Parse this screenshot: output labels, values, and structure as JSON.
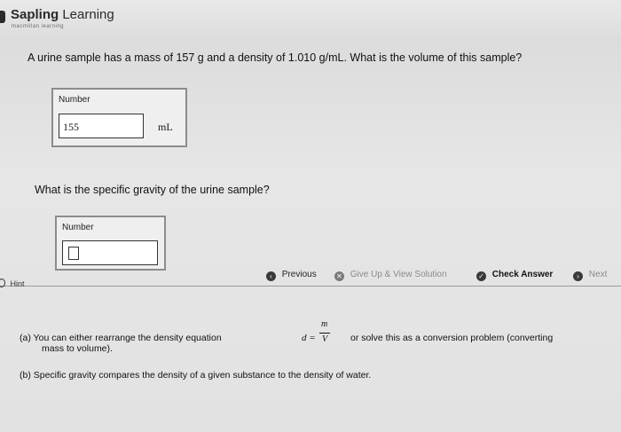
{
  "header": {
    "brand": "Sapling",
    "brand_suffix": "Learning",
    "sub": "macmillan learning"
  },
  "question1": {
    "text": "A urine sample has a mass of 157 g and a density of 1.010 g/mL. What is the volume of this sample?",
    "box_label": "Number",
    "value": "155",
    "unit": "mL"
  },
  "question2": {
    "text": "What is the specific gravity of the urine sample?",
    "box_label": "Number",
    "value": ""
  },
  "actions": {
    "hint": "Hint",
    "previous": "Previous",
    "give_up": "Give Up & View Solution",
    "check": "Check Answer",
    "next": "Next"
  },
  "hints": {
    "a_part1": "(a) You can either rearrange the density equation",
    "a_part2": "mass to volume).",
    "a_part3": "or solve this as a conversion problem (converting",
    "b": "(b) Specific gravity compares the density of a given substance to the density of water.",
    "formula": {
      "lhs": "d",
      "eq": "=",
      "numerator": "m",
      "denominator": "V"
    }
  },
  "icons": {
    "previous": "chevron-left-icon",
    "give_up": "give-up-icon",
    "check": "checkmark-icon",
    "next": "chevron-right-icon",
    "hint": "lightbulb-icon"
  }
}
